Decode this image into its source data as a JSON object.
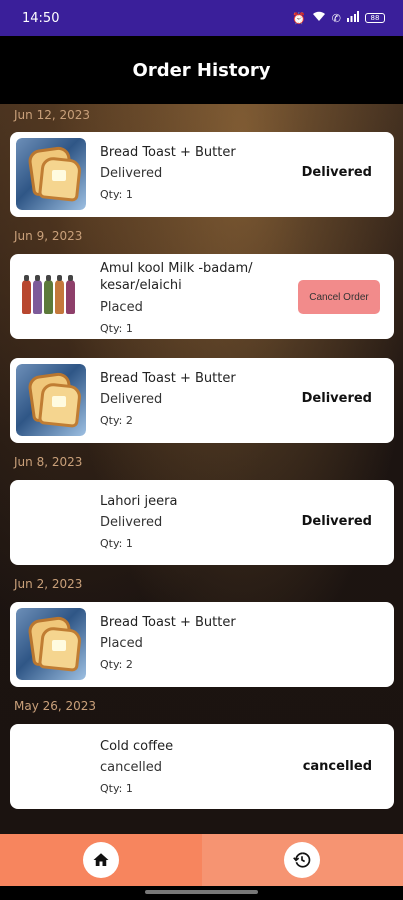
{
  "status_bar": {
    "time": "14:50",
    "battery": "88"
  },
  "app_bar": {
    "title": "Order History"
  },
  "groups": [
    {
      "date": "Jun 12, 2023",
      "orders": [
        {
          "name": "Bread Toast + Butter",
          "status": "Delivered",
          "qty": "Qty: 1",
          "right_label": "Delivered",
          "image": "bread-toast"
        }
      ]
    },
    {
      "date": "Jun 9, 2023",
      "orders": [
        {
          "name": "Amul kool Milk -badam/ kesar/elaichi",
          "status": "Placed",
          "qty": "Qty: 1",
          "right_label": "Cancel Order",
          "image": "milk-bottles"
        },
        {
          "name": "Bread Toast + Butter",
          "status": "Delivered",
          "qty": "Qty: 2",
          "right_label": "Delivered",
          "image": "bread-toast"
        }
      ]
    },
    {
      "date": "Jun 8, 2023",
      "orders": [
        {
          "name": "Lahori jeera",
          "status": "Delivered",
          "qty": "Qty: 1",
          "right_label": "Delivered",
          "image": ""
        }
      ]
    },
    {
      "date": "Jun 2, 2023",
      "orders": [
        {
          "name": "Bread Toast + Butter",
          "status": "Placed",
          "qty": "Qty: 2",
          "right_label": "",
          "image": "bread-toast"
        }
      ]
    },
    {
      "date": "May 26, 2023",
      "orders": [
        {
          "name": "Cold coffee",
          "status": "cancelled",
          "qty": "Qty: 1",
          "right_label": "cancelled",
          "image": ""
        }
      ]
    }
  ],
  "bottom_nav": {
    "left_icon": "home-icon",
    "right_icon": "history-icon"
  },
  "colors": {
    "status_bar": "#3a1f9a",
    "nav_left": "#f7855e",
    "nav_right": "#f69472",
    "cancel_button": "#f28b8b",
    "date_text": "#c9a07a"
  }
}
